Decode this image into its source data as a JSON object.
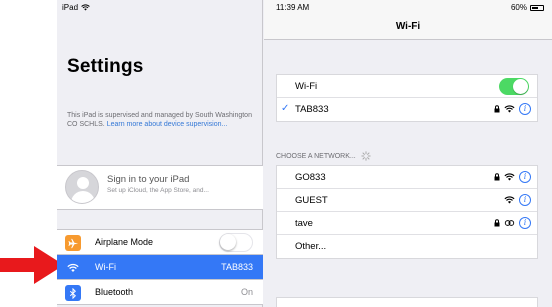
{
  "colors": {
    "accent": "#3478f6",
    "toggle_on": "#4cd964",
    "arrow": "#e8191c",
    "airplane": "#f79a2f",
    "bluetooth": "#3478f6"
  },
  "status": {
    "device": "iPad",
    "time": "11:39 AM",
    "battery": "60%"
  },
  "left": {
    "title": "Settings",
    "supervised_text": "This iPad is supervised and managed by South Washington CO SCHLS. ",
    "supervised_link": "Learn more about device supervision...",
    "signin_title": "Sign in to your iPad",
    "signin_subtitle": "Set up iCloud, the App Store, and...",
    "menu": [
      {
        "label": "Airplane Mode",
        "icon": "airplane-icon",
        "toggle": false
      },
      {
        "label": "Wi-Fi",
        "icon": "wifi-icon",
        "value": "TAB833",
        "selected": true
      },
      {
        "label": "Bluetooth",
        "icon": "bluetooth-icon",
        "value": "On"
      }
    ]
  },
  "right": {
    "title": "Wi-Fi",
    "wifi_label": "Wi-Fi",
    "wifi_on": true,
    "connected_network": "TAB833",
    "section_header": "CHOOSE A NETWORK...",
    "networks": [
      {
        "name": "GO833",
        "locked": true
      },
      {
        "name": "GUEST",
        "locked": false
      },
      {
        "name": "tave",
        "locked": true
      },
      {
        "name": "Other...",
        "other": true
      }
    ]
  }
}
